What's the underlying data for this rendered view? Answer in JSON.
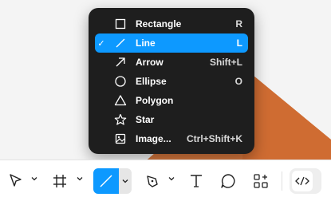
{
  "menu": {
    "items": [
      {
        "label": "Rectangle",
        "shortcut": "R",
        "icon": "rectangle-icon",
        "selected": false
      },
      {
        "label": "Line",
        "shortcut": "L",
        "icon": "line-icon",
        "selected": true
      },
      {
        "label": "Arrow",
        "shortcut": "Shift+L",
        "icon": "arrow-icon",
        "selected": false
      },
      {
        "label": "Ellipse",
        "shortcut": "O",
        "icon": "ellipse-icon",
        "selected": false
      },
      {
        "label": "Polygon",
        "shortcut": "",
        "icon": "polygon-icon",
        "selected": false
      },
      {
        "label": "Star",
        "shortcut": "",
        "icon": "star-icon",
        "selected": false
      },
      {
        "label": "Image...",
        "shortcut": "Ctrl+Shift+K",
        "icon": "image-icon",
        "selected": false
      }
    ],
    "check_mark": "✓"
  },
  "toolbar": {
    "tools": [
      {
        "name": "move-tool",
        "icon": "cursor-icon"
      },
      {
        "name": "frame-tool",
        "icon": "frame-icon"
      },
      {
        "name": "shape-tool",
        "icon": "line-icon",
        "active": true
      },
      {
        "name": "pen-tool",
        "icon": "pen-icon"
      },
      {
        "name": "text-tool",
        "icon": "text-icon"
      },
      {
        "name": "comment-tool",
        "icon": "comment-icon"
      },
      {
        "name": "actions-tool",
        "icon": "actions-icon"
      },
      {
        "name": "dev-mode-toggle",
        "icon": "code-icon"
      }
    ]
  },
  "colors": {
    "accent": "#0d99ff",
    "menu_bg": "#1e1e1e",
    "canvas_shape": "#d7773d"
  }
}
